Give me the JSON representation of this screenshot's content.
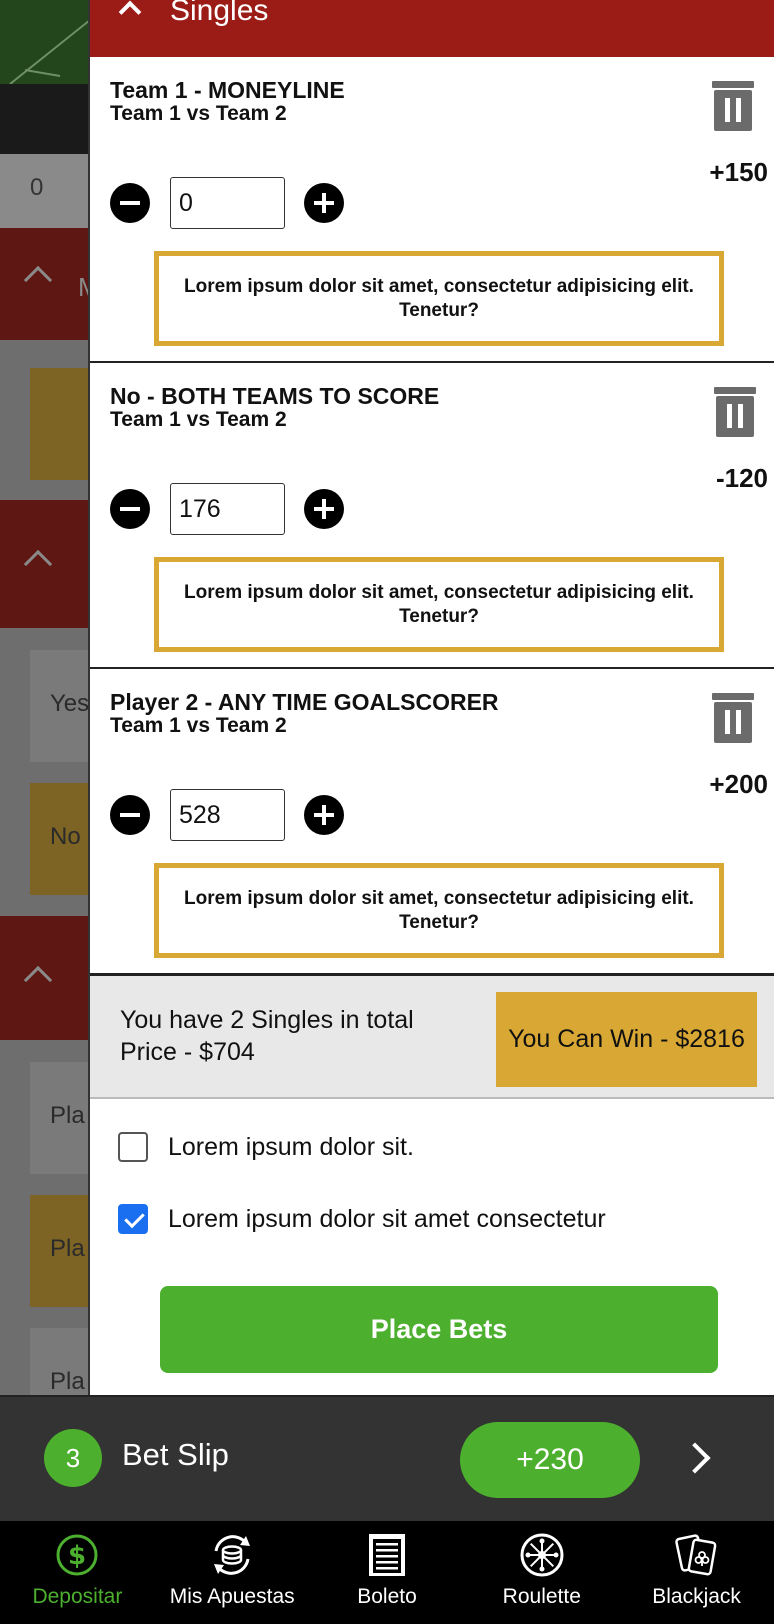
{
  "background": {
    "score_value": "0",
    "tile_labels": [
      "Yes",
      "No",
      "Pla",
      "Pla",
      "Pla"
    ]
  },
  "slip_panel": {
    "header_title": "Singles",
    "bets": [
      {
        "market": "Team 1 - MONEYLINE",
        "match": "Team 1 vs Team 2",
        "odds": "+150",
        "stake": "0",
        "notice": "Lorem ipsum dolor sit amet, consectetur adipisicing elit. Tenetur?"
      },
      {
        "market": "No - BOTH TEAMS TO SCORE",
        "match": "Team 1 vs Team 2",
        "odds": "-120",
        "stake": "176",
        "notice": "Lorem ipsum dolor sit amet, consectetur adipisicing elit. Tenetur?"
      },
      {
        "market": "Player 2 - ANY TIME GOALSCORER",
        "match": "Team 1 vs Team 2",
        "odds": "+200",
        "stake": "528",
        "notice": "Lorem ipsum dolor sit amet, consectetur adipisicing elit. Tenetur?"
      }
    ],
    "summary": {
      "line1": "You have 2 Singles in total",
      "line2": "Price - $704",
      "win_label": "You Can Win - $2816"
    },
    "options": [
      {
        "label": "Lorem ipsum dolor sit.",
        "checked": false
      },
      {
        "label": "Lorem ipsum dolor sit amet consectetur",
        "checked": true
      }
    ],
    "place_bets_label": "Place Bets"
  },
  "slip_bar": {
    "count": "3",
    "title": "Bet Slip",
    "odds": "+230"
  },
  "nav": {
    "items": [
      {
        "label": "Depositar",
        "icon": "dollar-coin-icon",
        "active": true
      },
      {
        "label": "Mis Apuestas",
        "icon": "coin-stack-refresh-icon",
        "active": false
      },
      {
        "label": "Boleto",
        "icon": "ticket-document-icon",
        "active": false
      },
      {
        "label": "Roulette",
        "icon": "roulette-wheel-icon",
        "active": false
      },
      {
        "label": "Blackjack",
        "icon": "playing-cards-icon",
        "active": false
      }
    ]
  },
  "colors": {
    "header_red": "#9b1c16",
    "accent_gold": "#d9a834",
    "accent_green": "#4caf2e",
    "checkbox_blue": "#1a6ff0"
  }
}
